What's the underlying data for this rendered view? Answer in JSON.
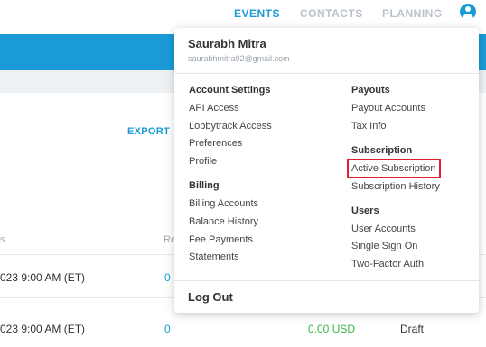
{
  "nav": {
    "events": "EVENTS",
    "contacts": "CONTACTS",
    "planning": "PLANNING"
  },
  "background": {
    "export_label": "EXPORT",
    "col_left_fragment": "s",
    "col_mid_fragment": "Re",
    "rows": [
      {
        "date": "023 9:00 AM (ET)",
        "count": "0",
        "amount": "",
        "status": ""
      },
      {
        "date": "023 9:00 AM (ET)",
        "count": "0",
        "amount": "0.00 USD",
        "status": "Draft"
      }
    ]
  },
  "user_menu": {
    "name": "Saurabh Mitra",
    "email": "saurabhmitra92@gmail.com",
    "account_settings": {
      "title": "Account Settings",
      "items": [
        "API Access",
        "Lobbytrack Access",
        "Preferences",
        "Profile"
      ]
    },
    "billing": {
      "title": "Billing",
      "items": [
        "Billing Accounts",
        "Balance History",
        "Fee Payments",
        "Statements"
      ]
    },
    "payouts": {
      "title": "Payouts",
      "items": [
        "Payout Accounts",
        "Tax Info"
      ]
    },
    "subscription": {
      "title": "Subscription",
      "items": [
        "Active Subscription",
        "Subscription History"
      ]
    },
    "users": {
      "title": "Users",
      "items": [
        "User Accounts",
        "Single Sign On",
        "Two-Factor Auth"
      ]
    },
    "logout": "Log Out"
  },
  "colors": {
    "accent": "#1a9bd7",
    "highlight_box": "#e0202e",
    "amount_green": "#3bb54a"
  }
}
